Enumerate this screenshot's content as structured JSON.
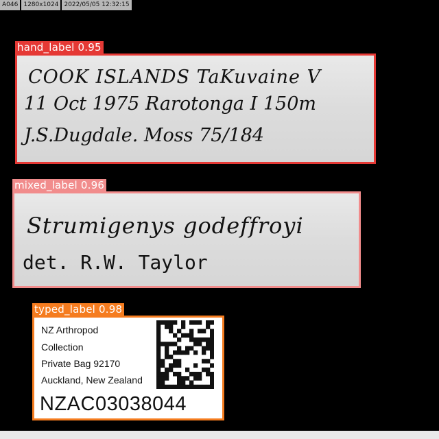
{
  "header": {
    "camera_id": "A046",
    "resolution": "1280x1024",
    "timestamp": "2022/05/05 12:32:15"
  },
  "detections": [
    {
      "class_label": "hand_label",
      "confidence": "0.95",
      "color": "#e53935",
      "lines": [
        "COOK ISLANDS  TaKuvaine V",
        "11 Oct 1975  Rarotonga I  150m",
        "J.S.Dugdale.  Moss  75/184"
      ]
    },
    {
      "class_label": "mixed_label",
      "confidence": "0.96",
      "color": "#f18c8c",
      "lines": [
        "Strumigenys  godeffroyi",
        "det. R.W. Taylor"
      ]
    },
    {
      "class_label": "typed_label",
      "confidence": "0.98",
      "color": "#f57c1f",
      "lines": [
        "NZ Arthropod",
        "Collection",
        "Private Bag 92170",
        "Auckland, New Zealand"
      ],
      "barcode_number": "NZAC03038044"
    }
  ]
}
